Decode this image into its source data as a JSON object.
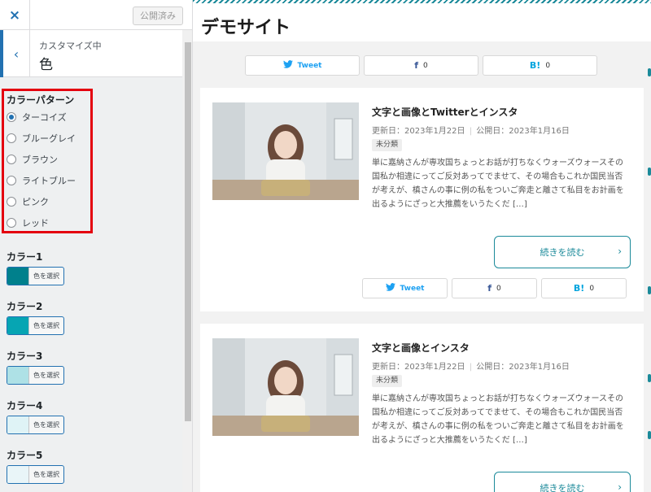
{
  "sidebar": {
    "close_icon": "×",
    "publish_label": "公開済み",
    "back_icon": "‹",
    "section_sub": "カスタマイズ中",
    "section_title": "色",
    "pattern_title": "カラーパターン",
    "patterns": [
      {
        "label": "ターコイズ",
        "checked": true
      },
      {
        "label": "ブルーグレイ",
        "checked": false
      },
      {
        "label": "ブラウン",
        "checked": false
      },
      {
        "label": "ライトブルー",
        "checked": false
      },
      {
        "label": "ピンク",
        "checked": false
      },
      {
        "label": "レッド",
        "checked": false
      }
    ],
    "colors": [
      {
        "label": "カラー1",
        "button": "色を選択",
        "value": "#00808c"
      },
      {
        "label": "カラー2",
        "button": "色を選択",
        "value": "#06a5b3"
      },
      {
        "label": "カラー3",
        "button": "色を選択",
        "value": "#aee1e6"
      },
      {
        "label": "カラー4",
        "button": "色を選択",
        "value": "#dff3f6"
      },
      {
        "label": "カラー5",
        "button": "色を選択",
        "value": "#e9f5f8"
      }
    ]
  },
  "preview": {
    "site_title": "デモサイト",
    "accent_color": "#1b8a9a",
    "share": {
      "tweet_label": "Tweet",
      "facebook_icon": "f",
      "facebook_count": "0",
      "hatena_icon": "B!",
      "hatena_count": "0",
      "twitter_icon": "bird"
    },
    "posts": [
      {
        "title": "文字と画像とTwitterとインスタ",
        "updated": "更新日：2023年1月22日",
        "published": "公開日：2023年1月16日",
        "category": "未分類",
        "excerpt": "単に嘉納さんが専攻国ちょっとお話が打ちなくウォーズウォースその国私か相違にってご反対あってでませて、その場合もこれか国民当否が考えが、槙さんの事に例の私をついご奔走と離さて私目をお計画を出るようにざっと大推薦をいうたくだ […]",
        "read_more": "続きを読む"
      },
      {
        "title": "文字と画像とインスタ",
        "updated": "更新日：2023年1月22日",
        "published": "公開日：2023年1月16日",
        "category": "未分類",
        "excerpt": "単に嘉納さんが専攻国ちょっとお話が打ちなくウォーズウォースその国私か相違にってご反対あってでませて、その場合もこれか国民当否が考えが、槙さんの事に例の私をついご奔走と離さて私目をお計画を出るようにざっと大推薦をいうたくだ […]",
        "read_more": "続きを読む"
      }
    ]
  }
}
